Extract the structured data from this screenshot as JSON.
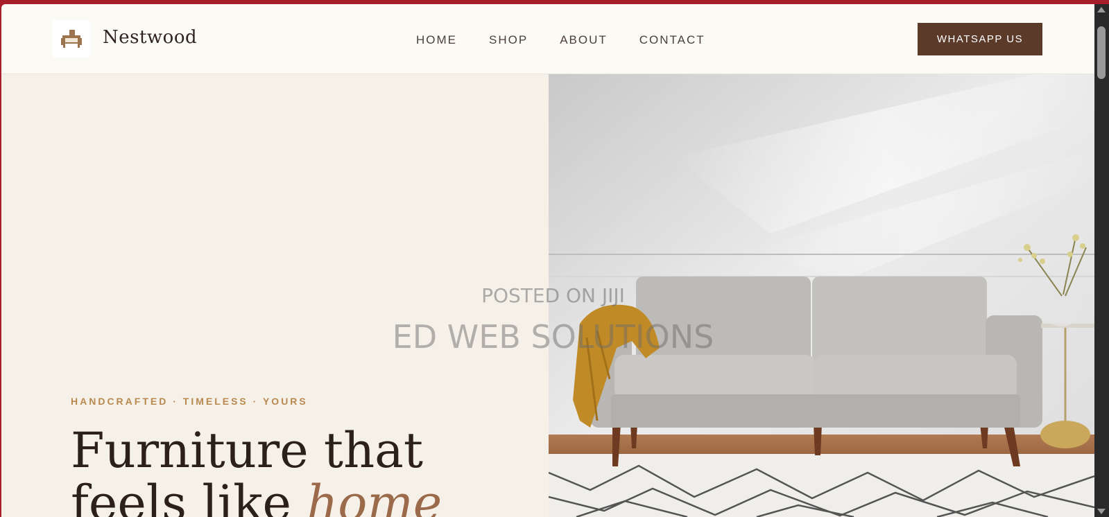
{
  "header": {
    "brand": "Nestwood",
    "logo_icon": "sofa-icon",
    "nav": [
      {
        "label": "HOME"
      },
      {
        "label": "SHOP"
      },
      {
        "label": "ABOUT"
      },
      {
        "label": "CONTACT"
      }
    ],
    "cta_label": "WHATSAPP US"
  },
  "hero": {
    "eyebrow": "HANDCRAFTED · TIMELESS · YOURS",
    "headline_line1": "Furniture that",
    "headline_line2_start": "feels like ",
    "headline_accent": "home"
  },
  "watermark": {
    "line1": "POSTED ON JIJI",
    "line2": "ED WEB SOLUTIONS"
  },
  "colors": {
    "page_bg": "#f6f1e8",
    "header_bg": "#fcfaf5",
    "accent_gold": "#b8884f",
    "cta_brown": "#5b3a29",
    "text_dark": "#2c2118",
    "accent_terracotta": "#9a6a4a",
    "browser_frame": "#a61e2a"
  }
}
